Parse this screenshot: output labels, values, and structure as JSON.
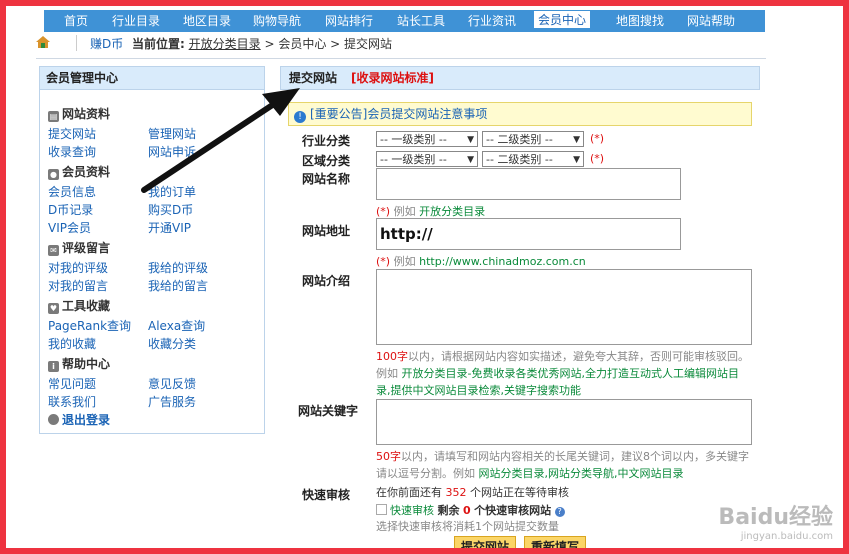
{
  "topnav": [
    "首页",
    "行业目录",
    "地区目录",
    "购物导航",
    "网站排行",
    "站长工具",
    "行业资讯",
    "会员中心",
    "地图搜找",
    "网站帮助"
  ],
  "crumb": {
    "coin": "赚D币",
    "label": "当前位置:",
    "link": "开放分类目录",
    "rest": " > 会员中心 > 提交网站"
  },
  "left": {
    "title": "会员管理中心",
    "sections": [
      {
        "title": "网站资料",
        "links": [
          [
            "提交网站",
            "管理网站"
          ],
          [
            "收录查询",
            "网站申诉"
          ]
        ]
      },
      {
        "title": "会员资料",
        "links": [
          [
            "会员信息",
            "我的订单"
          ],
          [
            "D币记录",
            "购买D币"
          ],
          [
            "VIP会员",
            "开通VIP"
          ]
        ]
      },
      {
        "title": "评级留言",
        "links": [
          [
            "对我的评级",
            "我给的评级"
          ],
          [
            "对我的留言",
            "我给的留言"
          ]
        ]
      },
      {
        "title": "工具收藏",
        "links": [
          [
            "PageRank查询",
            "Alexa查询"
          ],
          [
            "我的收藏",
            "收藏分类"
          ]
        ]
      },
      {
        "title": "帮助中心",
        "links": [
          [
            "常见问题",
            "意见反馈"
          ],
          [
            "联系我们",
            "广告服务"
          ]
        ]
      }
    ],
    "logout": "退出登录"
  },
  "main": {
    "title": "提交网站",
    "standard": "[收录网站标准]",
    "notice": "[重要公告]会员提交网站注意事项",
    "industry_label": "行业分类",
    "region_label": "区域分类",
    "sel1": "-- 一级类别 --",
    "sel2": "-- 二级类别 --",
    "req": "(*)",
    "name_label": "网站名称",
    "name_hint_pre": "例如",
    "name_hint": "开放分类目录",
    "url_label": "网站地址",
    "url_value": "http://",
    "url_hint": "http://www.chinadmoz.com.cn",
    "intro_label": "网站介绍",
    "intro_count": "100字",
    "intro_desc": "以内，请根据网站内容如实描述，避免夸大其辞，否则可能审核驳回。例如",
    "intro_example": "开放分类目录-免费收录各类优秀网站,全力打造互动式人工编辑网站目录,提供中文网站目录检索,关键字搜索功能",
    "kw_label": "网站关键字",
    "kw_count": "50字",
    "kw_desc": "以内，请填写和网站内容相关的长尾关键词，建议8个词以内，多关键字请以逗号分割。例如",
    "kw_example": "网站分类目录,网站分类导航,中文网站目录",
    "fast_label": "快速审核",
    "fast_pre": "在你前面还有",
    "fast_count": "352",
    "fast_post": "个网站正在等待审核",
    "fast_check": "快速审核",
    "fast_left_pre": "剩余",
    "fast_left": "0",
    "fast_left_post": "个快速审核网站",
    "fast_note": "选择快速审核将消耗1个网站提交数量",
    "submit": "提交网站",
    "reset": "重新填写"
  },
  "watermark": {
    "brand": "Baidu经验",
    "url": "jingyan.baidu.com"
  }
}
